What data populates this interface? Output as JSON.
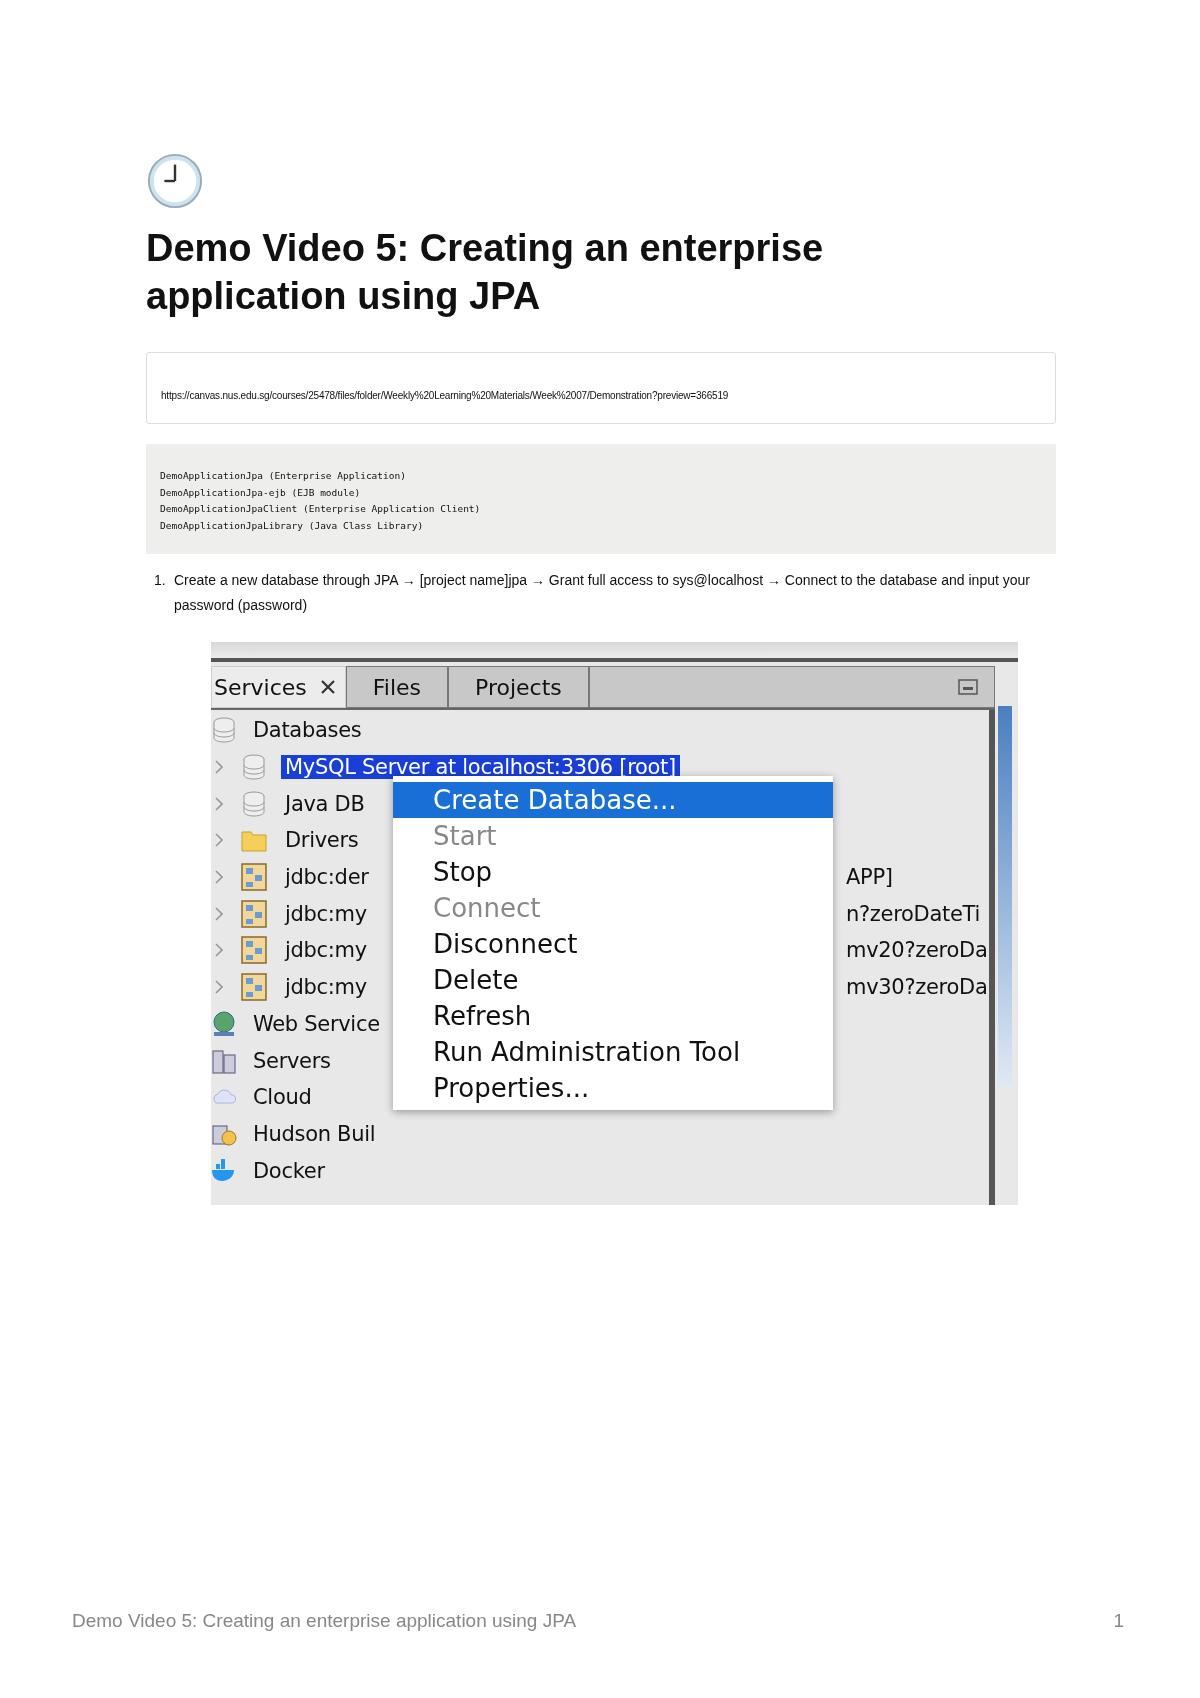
{
  "header": {
    "title": "Demo Video 5: Creating an enterprise application using JPA"
  },
  "link_box": {
    "url": "https://canvas.nus.edu.sg/courses/25478/files/folder/Weekly%20Learning%20Materials/Week%2007/Demonstration?preview=366519"
  },
  "code_block": {
    "lines": [
      "DemoApplicationJpa (Enterprise Application)",
      "DemoApplicationJpa-ejb (EJB module)",
      "DemoApplicationJpaClient (Enterprise Application Client)",
      "DemoApplicationJpaLibrary (Java Class Library)"
    ]
  },
  "steps": [
    {
      "number": "1.",
      "text": "Create a new database through JPA → [project name]jpa → Grant full access to sys@localhost → Connect to the database and input your password (password)"
    }
  ],
  "screenshot": {
    "tabs": [
      {
        "label": "Services",
        "selected": true,
        "closable": true
      },
      {
        "label": "Files",
        "selected": false,
        "closable": false
      },
      {
        "label": "Projects",
        "selected": false,
        "closable": false
      }
    ],
    "tree": [
      {
        "label": "Databases",
        "kind": "database",
        "selected": false,
        "children": [
          {
            "label": "MySQL Server at localhost:3306 [root]",
            "kind": "database",
            "selected": true
          },
          {
            "label": "Java DB",
            "kind": "database",
            "selected": false
          },
          {
            "label": "Drivers",
            "kind": "folder",
            "selected": false
          },
          {
            "label": "jdbc:der",
            "tail": "APP]",
            "kind": "connection",
            "selected": false
          },
          {
            "label": "jdbc:my",
            "tail": "n?zeroDateTi",
            "kind": "connection",
            "selected": false
          },
          {
            "label": "jdbc:my",
            "tail": "mv20?zeroDa",
            "kind": "connection",
            "selected": false
          },
          {
            "label": "jdbc:my",
            "tail": "mv30?zeroDa",
            "kind": "connection",
            "selected": false
          }
        ]
      },
      {
        "label": "Web Service",
        "kind": "globe",
        "selected": false
      },
      {
        "label": "Servers",
        "kind": "server",
        "selected": false
      },
      {
        "label": "Cloud",
        "kind": "cloud",
        "selected": false
      },
      {
        "label": "Hudson Buil",
        "kind": "builder",
        "selected": false
      },
      {
        "label": "Docker",
        "kind": "docker",
        "selected": false
      }
    ],
    "context_menu": {
      "items": [
        {
          "label": "Create Database...",
          "selected": true,
          "disabled": false
        },
        {
          "label": "Start",
          "selected": false,
          "disabled": true
        },
        {
          "label": "Stop",
          "selected": false,
          "disabled": false
        },
        {
          "label": "Connect",
          "selected": false,
          "disabled": true
        },
        {
          "label": "Disconnect",
          "selected": false,
          "disabled": false
        },
        {
          "label": "Delete",
          "selected": false,
          "disabled": false
        },
        {
          "label": "Refresh",
          "selected": false,
          "disabled": false
        },
        {
          "label": "Run Administration Tool",
          "selected": false,
          "disabled": false
        },
        {
          "label": "Properties...",
          "selected": false,
          "disabled": false
        }
      ]
    }
  },
  "footer": {
    "title": "Demo Video 5: Creating an enterprise application using JPA",
    "page": "1"
  }
}
